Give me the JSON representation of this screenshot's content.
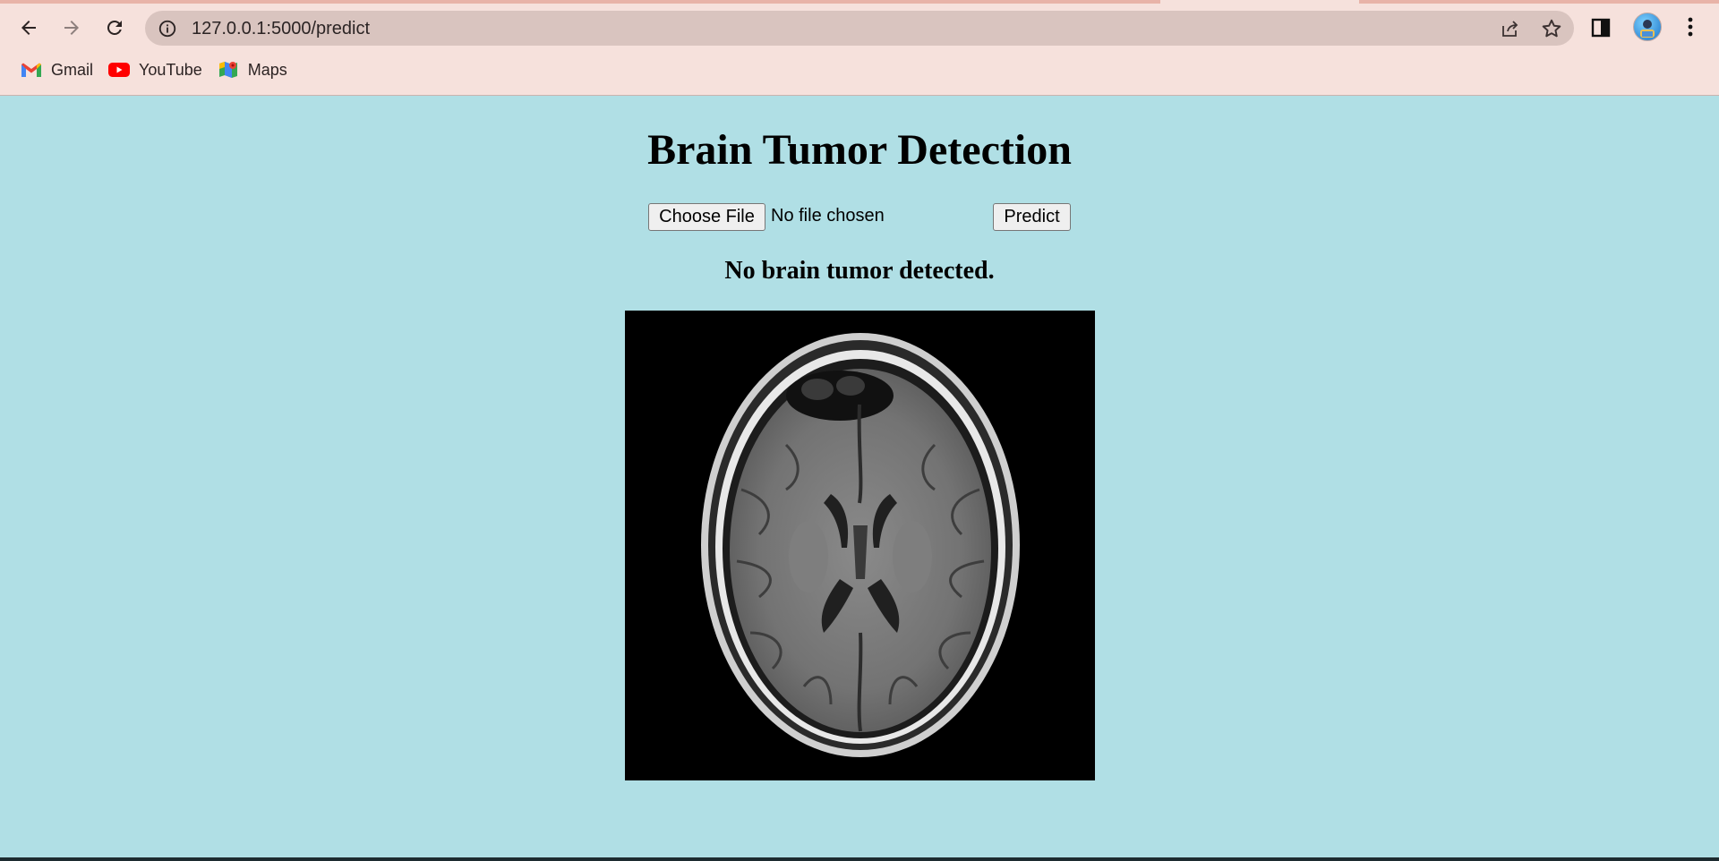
{
  "browser": {
    "url": "127.0.0.1:5000/predict",
    "bookmarks": [
      {
        "label": "Gmail",
        "icon": "gmail-icon"
      },
      {
        "label": "YouTube",
        "icon": "youtube-icon"
      },
      {
        "label": "Maps",
        "icon": "maps-icon"
      }
    ]
  },
  "page": {
    "title": "Brain Tumor Detection",
    "file_button_label": "Choose File",
    "file_status": "No file chosen",
    "predict_label": "Predict",
    "result": "No brain tumor detected.",
    "image_alt": "brain MRI scan"
  },
  "colors": {
    "page_background": "#b0dfe5",
    "chrome_background": "#f6e1dc",
    "omnibox_background": "#d9c4bf"
  }
}
